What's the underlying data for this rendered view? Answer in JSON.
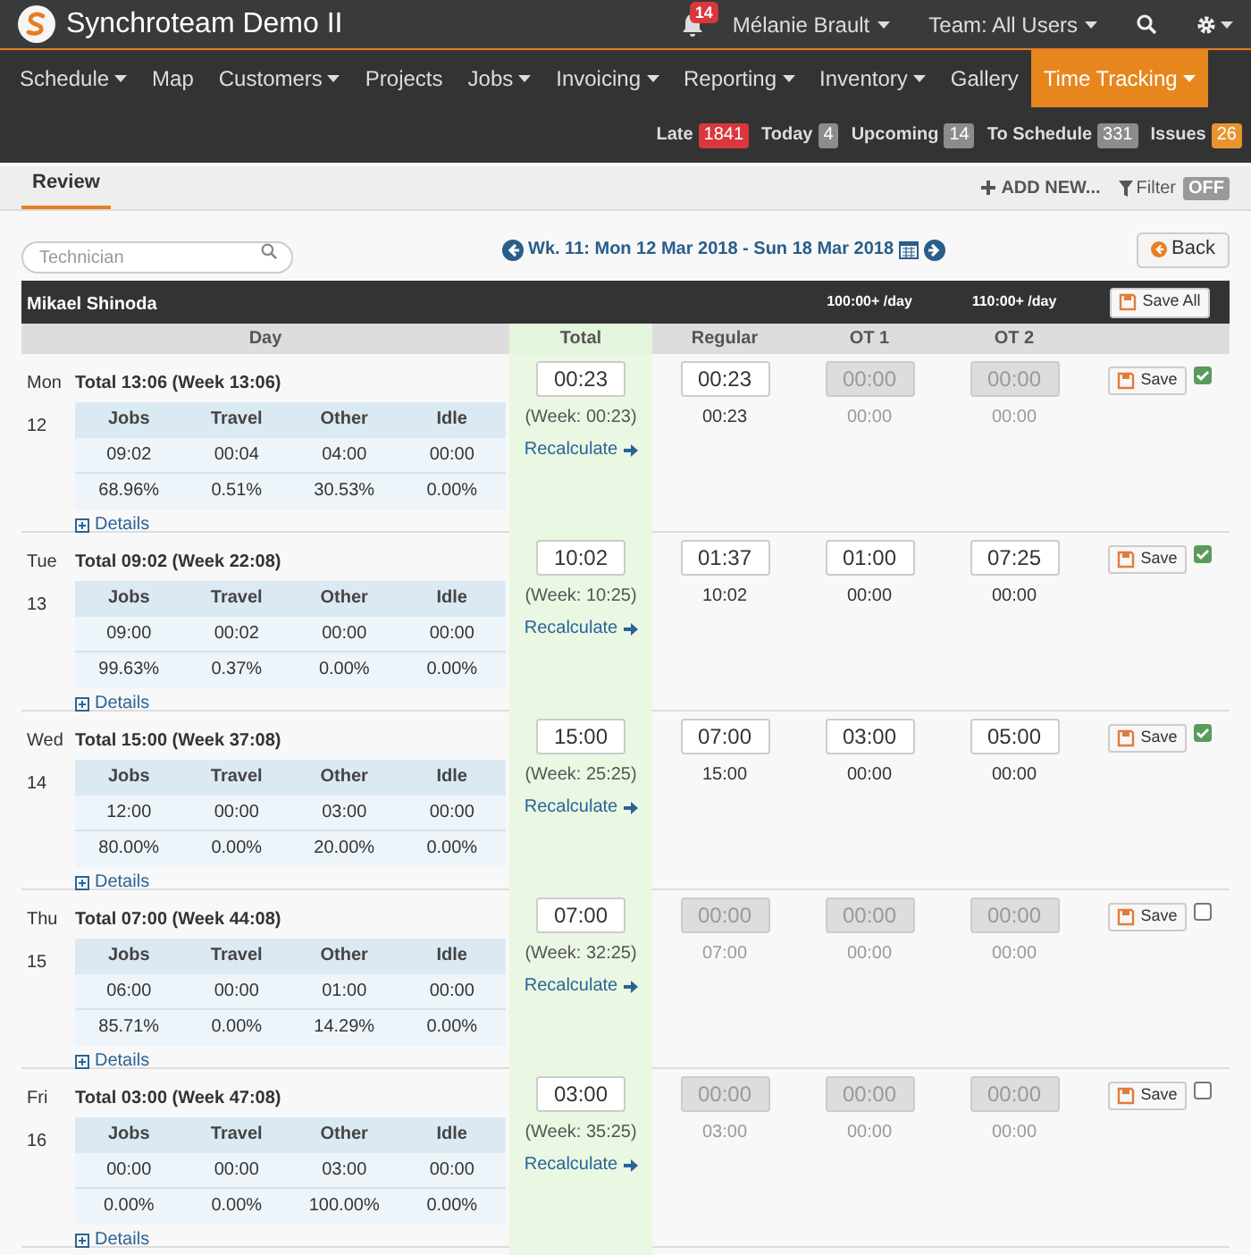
{
  "app": {
    "title": "Synchroteam Demo II",
    "notifications": "14",
    "user": "Mélanie Brault",
    "team": "Team: All Users"
  },
  "nav": [
    {
      "label": "Schedule",
      "dropdown": true,
      "selected": false
    },
    {
      "label": "Map",
      "dropdown": false,
      "selected": false
    },
    {
      "label": "Customers",
      "dropdown": true,
      "selected": false
    },
    {
      "label": "Projects",
      "dropdown": false,
      "selected": false
    },
    {
      "label": "Jobs",
      "dropdown": true,
      "selected": false
    },
    {
      "label": "Invoicing",
      "dropdown": true,
      "selected": false
    },
    {
      "label": "Reporting",
      "dropdown": true,
      "selected": false
    },
    {
      "label": "Inventory",
      "dropdown": true,
      "selected": false
    },
    {
      "label": "Gallery",
      "dropdown": false,
      "selected": false
    },
    {
      "label": "Time Tracking",
      "dropdown": true,
      "selected": true
    }
  ],
  "status_counts": [
    {
      "label": "Late",
      "count": "1841",
      "color": "#d9373b"
    },
    {
      "label": "Today",
      "count": "4",
      "color": "#8c8c8c"
    },
    {
      "label": "Upcoming",
      "count": "14",
      "color": "#8c8c8c"
    },
    {
      "label": "To Schedule",
      "count": "331",
      "color": "#8c8c8c"
    },
    {
      "label": "Issues",
      "count": "26",
      "color": "#e8952f"
    }
  ],
  "subheader": {
    "tabs": [
      {
        "label": "Review",
        "selected": true
      }
    ],
    "add_new": "ADD NEW...",
    "filter": "Filter",
    "filter_state": "OFF"
  },
  "toolbar": {
    "search_placeholder": "Technician",
    "week": "Wk. 11: Mon 12 Mar 2018 - Sun 18 Mar 2018",
    "back": "Back"
  },
  "technician": {
    "name": "Mikael Shinoda",
    "ot1_threshold": "100:00+ /day",
    "ot2_threshold": "110:00+ /day",
    "save_all": "Save All"
  },
  "columns": [
    "Day",
    "Total",
    "Regular",
    "OT 1",
    "OT 2"
  ],
  "days": [
    {
      "weekday": "Mon",
      "date": "12",
      "summary": "Total 13:06 (Week 13:06)",
      "stats_headers": [
        "Jobs",
        "Travel",
        "Other",
        "Idle"
      ],
      "times": [
        "09:02",
        "00:04",
        "04:00",
        "00:00"
      ],
      "percents": [
        "68.96%",
        "0.51%",
        "30.53%",
        "0.00%"
      ],
      "details": "Details",
      "total": "00:23",
      "week": "(Week: 00:23)",
      "recalculate": "Recalculate",
      "fields": [
        {
          "value": "00:23",
          "sub": "00:23",
          "disabled": false
        },
        {
          "value": "00:00",
          "sub": "00:00",
          "disabled": true
        },
        {
          "value": "00:00",
          "sub": "00:00",
          "disabled": true
        }
      ],
      "save": "Save",
      "checked": true
    },
    {
      "weekday": "Tue",
      "date": "13",
      "summary": "Total 09:02 (Week 22:08)",
      "stats_headers": [
        "Jobs",
        "Travel",
        "Other",
        "Idle"
      ],
      "times": [
        "09:00",
        "00:02",
        "00:00",
        "00:00"
      ],
      "percents": [
        "99.63%",
        "0.37%",
        "0.00%",
        "0.00%"
      ],
      "details": "Details",
      "total": "10:02",
      "week": "(Week: 10:25)",
      "recalculate": "Recalculate",
      "fields": [
        {
          "value": "01:37",
          "sub": "10:02",
          "disabled": false
        },
        {
          "value": "01:00",
          "sub": "00:00",
          "disabled": false
        },
        {
          "value": "07:25",
          "sub": "00:00",
          "disabled": false
        }
      ],
      "save": "Save",
      "checked": true
    },
    {
      "weekday": "Wed",
      "date": "14",
      "summary": "Total 15:00 (Week 37:08)",
      "stats_headers": [
        "Jobs",
        "Travel",
        "Other",
        "Idle"
      ],
      "times": [
        "12:00",
        "00:00",
        "03:00",
        "00:00"
      ],
      "percents": [
        "80.00%",
        "0.00%",
        "20.00%",
        "0.00%"
      ],
      "details": "Details",
      "total": "15:00",
      "week": "(Week: 25:25)",
      "recalculate": "Recalculate",
      "fields": [
        {
          "value": "07:00",
          "sub": "15:00",
          "disabled": false
        },
        {
          "value": "03:00",
          "sub": "00:00",
          "disabled": false
        },
        {
          "value": "05:00",
          "sub": "00:00",
          "disabled": false
        }
      ],
      "save": "Save",
      "checked": true
    },
    {
      "weekday": "Thu",
      "date": "15",
      "summary": "Total 07:00 (Week 44:08)",
      "stats_headers": [
        "Jobs",
        "Travel",
        "Other",
        "Idle"
      ],
      "times": [
        "06:00",
        "00:00",
        "01:00",
        "00:00"
      ],
      "percents": [
        "85.71%",
        "0.00%",
        "14.29%",
        "0.00%"
      ],
      "details": "Details",
      "total": "07:00",
      "week": "(Week: 32:25)",
      "recalculate": "Recalculate",
      "fields": [
        {
          "value": "00:00",
          "sub": "07:00",
          "disabled": true
        },
        {
          "value": "00:00",
          "sub": "00:00",
          "disabled": true
        },
        {
          "value": "00:00",
          "sub": "00:00",
          "disabled": true
        }
      ],
      "save": "Save",
      "checked": false
    },
    {
      "weekday": "Fri",
      "date": "16",
      "summary": "Total 03:00 (Week 47:08)",
      "stats_headers": [
        "Jobs",
        "Travel",
        "Other",
        "Idle"
      ],
      "times": [
        "00:00",
        "00:00",
        "03:00",
        "00:00"
      ],
      "percents": [
        "0.00%",
        "0.00%",
        "100.00%",
        "0.00%"
      ],
      "details": "Details",
      "total": "03:00",
      "week": "(Week: 35:25)",
      "recalculate": "Recalculate",
      "fields": [
        {
          "value": "00:00",
          "sub": "03:00",
          "disabled": true
        },
        {
          "value": "00:00",
          "sub": "00:00",
          "disabled": true
        },
        {
          "value": "00:00",
          "sub": "00:00",
          "disabled": true
        }
      ],
      "save": "Save",
      "checked": false
    }
  ]
}
